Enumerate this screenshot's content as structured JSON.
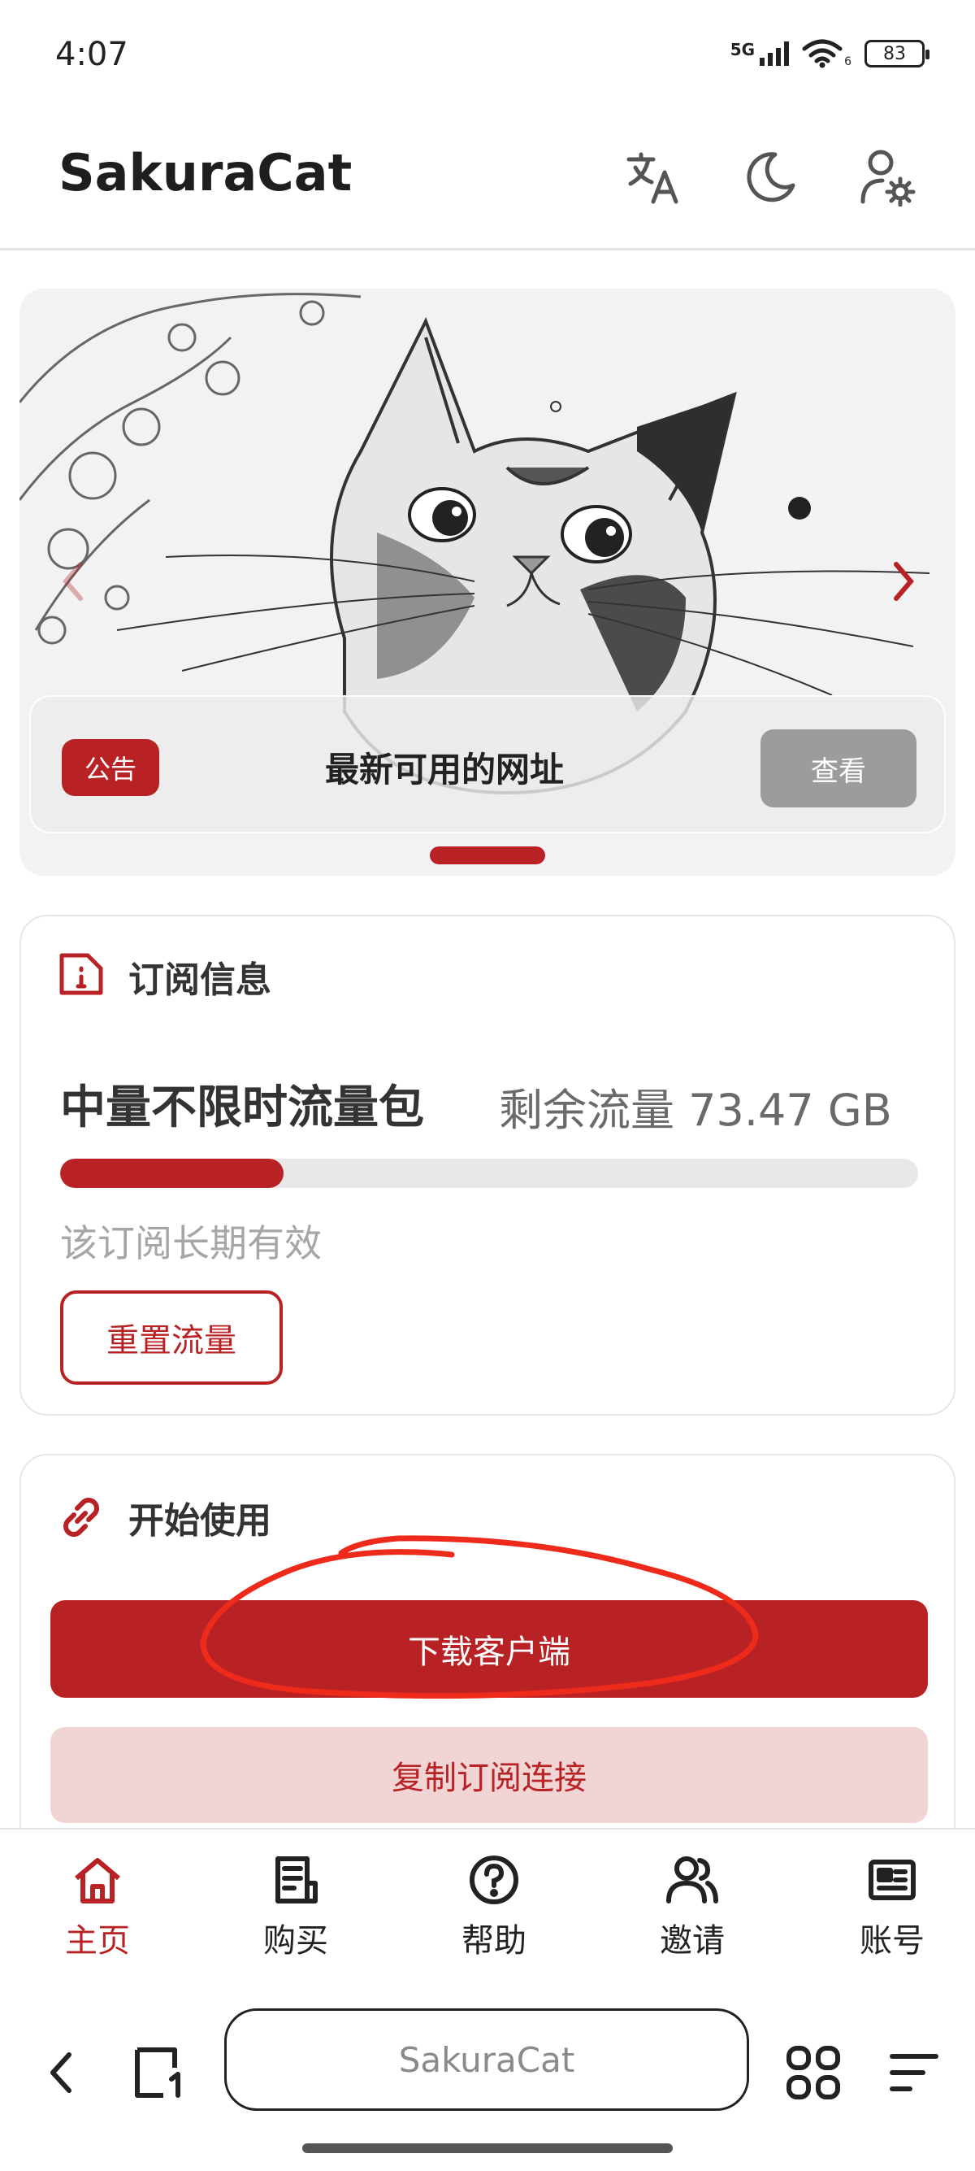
{
  "status_bar": {
    "time": "4:07",
    "network": "5G",
    "wifi_sub": "6",
    "battery": "83"
  },
  "header": {
    "title": "SakuraCat",
    "icons": [
      "translate-icon",
      "moon-icon",
      "user-settings-icon"
    ]
  },
  "banner": {
    "notice_tag": "公告",
    "notice_text": "最新可用的网址",
    "view_button": "查看",
    "slide_count": 1,
    "active_slide": 0
  },
  "subscription": {
    "title": "订阅信息",
    "plan_name": "中量不限时流量包",
    "remaining_label": "剩余流量 73.47 GB",
    "usage_fraction": 0.26,
    "validity": "该订阅长期有效",
    "reset_button": "重置流量"
  },
  "getting_started": {
    "title": "开始使用",
    "download_button": "下载客户端",
    "copy_button": "复制订阅连接"
  },
  "tabs": [
    {
      "label": "主页",
      "icon": "home-icon",
      "active": true
    },
    {
      "label": "购买",
      "icon": "document-icon",
      "active": false
    },
    {
      "label": "帮助",
      "icon": "help-icon",
      "active": false
    },
    {
      "label": "邀请",
      "icon": "users-icon",
      "active": false
    },
    {
      "label": "账号",
      "icon": "account-card-icon",
      "active": false
    }
  ],
  "browser": {
    "url_text": "SakuraCat"
  },
  "colors": {
    "accent": "#b82225",
    "accent_light": "#f1d4d4",
    "annotation": "#ee2a1b"
  }
}
